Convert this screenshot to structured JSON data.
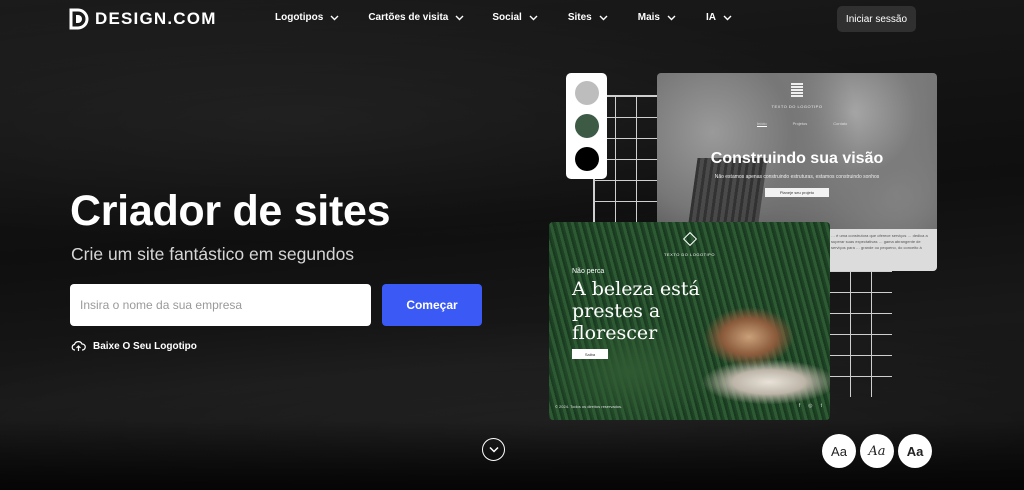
{
  "header": {
    "logo_text": "DESIGN.COM",
    "nav": [
      {
        "label": "Logotipos"
      },
      {
        "label": "Cartões de visita"
      },
      {
        "label": "Social"
      },
      {
        "label": "Sites"
      },
      {
        "label": "Mais"
      },
      {
        "label": "IA"
      }
    ],
    "login_label": "Iniciar sessão"
  },
  "hero": {
    "title": "Criador de sites",
    "subtitle": "Crie um site fantástico em segundos",
    "input_placeholder": "Insira o nome da sua empresa",
    "start_label": "Começar",
    "download_label": "Baixe O Seu Logotipo"
  },
  "palette": {
    "colors": [
      "#bdbdbd",
      "#3d5a45",
      "#000000"
    ]
  },
  "template_back": {
    "logo_text": "TEXTO DO LOGOTIPO",
    "nav": [
      "Início",
      "Projetos",
      "Contato"
    ],
    "title": "Construindo sua visão",
    "subtitle": "Não estamos apenas construindo estruturas, estamos construindo sonhos",
    "button": "Planeje seu projeto",
    "panel_text": "… é uma construtora que oferece serviços … dedica a superar suas expectativas … gama abrangente de serviços para … grande ou pequeno, do conceito à"
  },
  "template_front": {
    "logo_text": "TEXTO DO LOGOTIPO",
    "kicker": "Não perca",
    "title": "A beleza está prestes a florescer",
    "button": "Saiba",
    "footer": "© 2024. Todos os direitos reservados.",
    "social": [
      "f",
      "◎",
      "t"
    ]
  },
  "font_samples": [
    {
      "label": "Aa",
      "style": "sans"
    },
    {
      "label": "Aa",
      "style": "script"
    },
    {
      "label": "Aa",
      "style": "bold"
    }
  ]
}
